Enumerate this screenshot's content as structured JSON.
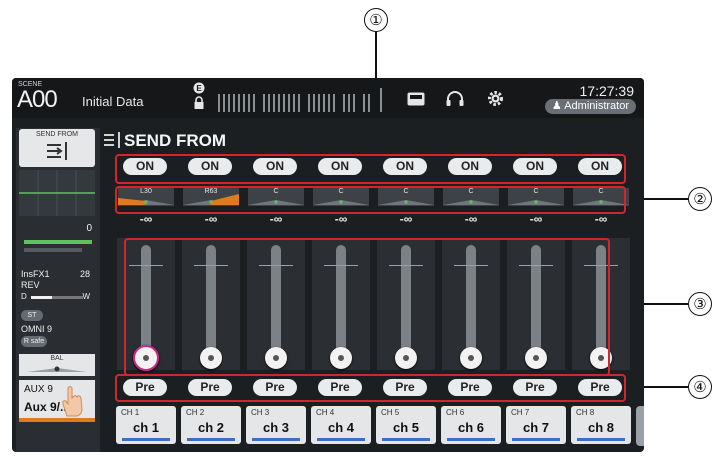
{
  "callouts": [
    "①",
    "②",
    "③",
    "④"
  ],
  "header": {
    "scene_label": "SCENE",
    "scene_number": "A00",
    "scene_name": "Initial Data",
    "clock": "17:27:39",
    "user": "Administrator",
    "icons": [
      "e-badge-icon",
      "lock-icon",
      "meter-icon",
      "recorder-icon",
      "headphones-icon",
      "gear-icon"
    ]
  },
  "strip": {
    "send_from_label": "SEND FROM",
    "fader_value": "0",
    "insert_name": "InsFX1",
    "insert_value": "28",
    "insert_type": "REV",
    "dry": "D",
    "wet": "W",
    "st_label": "ST",
    "omni": "OMNI 9",
    "rsafe": "R safe",
    "bal": "BAL",
    "aux_number": "AUX 9",
    "aux_name": "Aux 9/.."
  },
  "main": {
    "title": "SEND FROM",
    "channels": [
      {
        "on": "ON",
        "pan": "L30",
        "level": "-∞",
        "pre": "Pre",
        "num": "CH 1",
        "name": "ch 1"
      },
      {
        "on": "ON",
        "pan": "R63",
        "level": "-∞",
        "pre": "Pre",
        "num": "CH 2",
        "name": "ch 2"
      },
      {
        "on": "ON",
        "pan": "C",
        "level": "-∞",
        "pre": "Pre",
        "num": "CH 3",
        "name": "ch 3"
      },
      {
        "on": "ON",
        "pan": "C",
        "level": "-∞",
        "pre": "Pre",
        "num": "CH 4",
        "name": "ch 4"
      },
      {
        "on": "ON",
        "pan": "C",
        "level": "-∞",
        "pre": "Pre",
        "num": "CH 5",
        "name": "ch 5"
      },
      {
        "on": "ON",
        "pan": "C",
        "level": "-∞",
        "pre": "Pre",
        "num": "CH 6",
        "name": "ch 6"
      },
      {
        "on": "ON",
        "pan": "C",
        "level": "-∞",
        "pre": "Pre",
        "num": "CH 7",
        "name": "ch 7"
      },
      {
        "on": "ON",
        "pan": "C",
        "level": "-∞",
        "pre": "Pre",
        "num": "CH 8",
        "name": "ch 8"
      }
    ]
  },
  "colors": {
    "highlight": "#d0272e",
    "pan_accent": "#e07a1e",
    "select_ring": "#d0268a",
    "channel_bar": "#3d6fc4"
  }
}
